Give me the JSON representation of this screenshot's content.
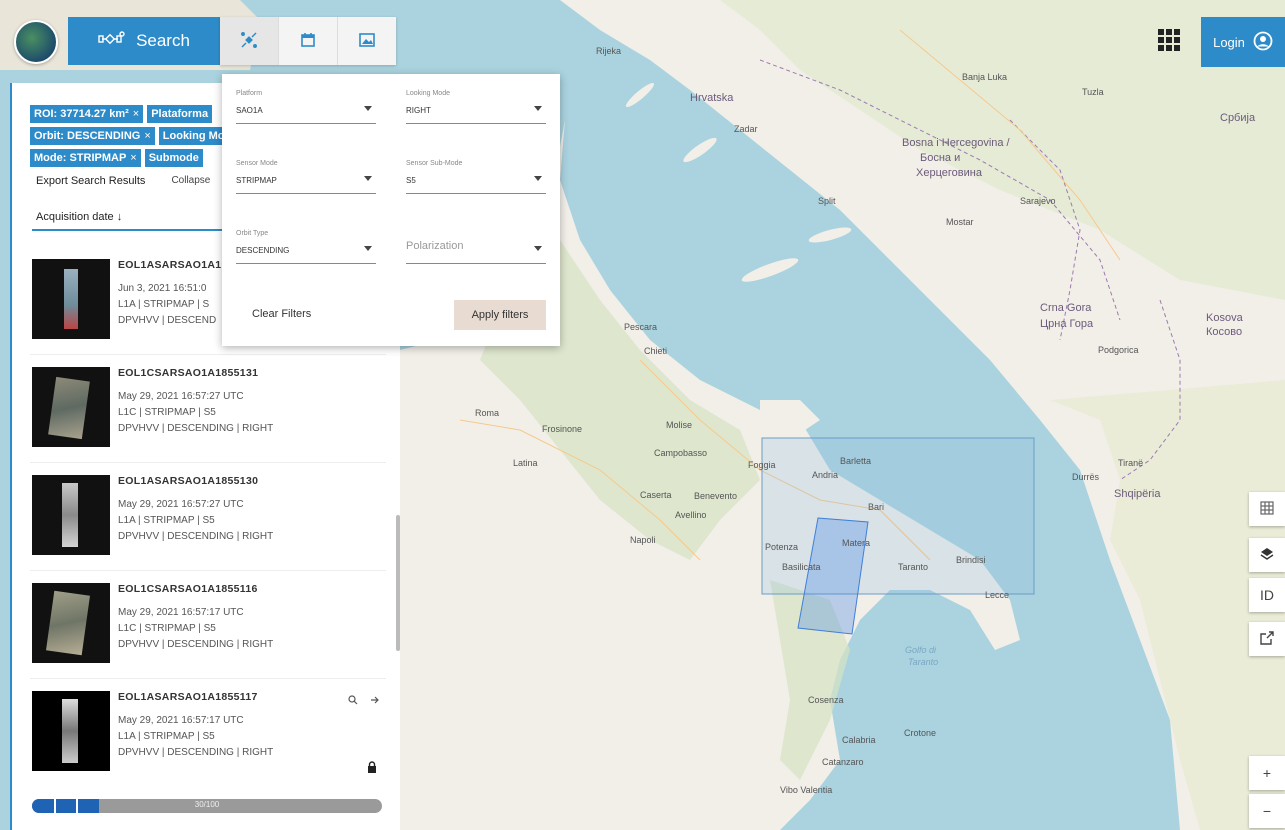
{
  "header": {
    "search_label": "Search",
    "login_label": "Login",
    "tool_tabs": [
      {
        "icon": "satellite-icon"
      },
      {
        "icon": "calendar-icon"
      },
      {
        "icon": "image-icon"
      }
    ]
  },
  "filters_chips": [
    {
      "label": "ROI: 37714.27 km²",
      "close": "×"
    },
    {
      "label": "Plataforma",
      "close": "×"
    },
    {
      "label": "Orbit: DESCENDING",
      "close": "×"
    },
    {
      "label": "Looking Mode",
      "close": "×"
    },
    {
      "label": "Mode: STRIPMAP",
      "close": "×"
    },
    {
      "label": "Submode",
      "close": "×"
    }
  ],
  "panel": {
    "export_label": "Export Search Results",
    "collapse_label": "Collapse",
    "sort_label": "Acquisition date ↓"
  },
  "filter_popup": {
    "platform": {
      "label": "Platform",
      "value": "SAO1A"
    },
    "looking_mode": {
      "label": "Looking Mode",
      "value": "RIGHT"
    },
    "sensor_mode": {
      "label": "Sensor Mode",
      "value": "STRIPMAP"
    },
    "sensor_submode": {
      "label": "Sensor Sub-Mode",
      "value": "S5"
    },
    "orbit_type": {
      "label": "Orbit Type",
      "value": "DESCENDING"
    },
    "polarization": {
      "placeholder": "Polarization"
    },
    "clear_label": "Clear Filters",
    "apply_label": "Apply filters"
  },
  "results": [
    {
      "id": "EOL1ASARSAO1A1",
      "date": "Jun 3, 2021 16:51:0",
      "level": "L1A | STRIPMAP | S",
      "pol": "DPVHVV | DESCEND"
    },
    {
      "id": "EOL1CSARSAO1A1855131",
      "date": "May 29, 2021 16:57:27 UTC",
      "level": "L1C | STRIPMAP | S5",
      "pol": "DPVHVV | DESCENDING | RIGHT"
    },
    {
      "id": "EOL1ASARSAO1A1855130",
      "date": "May 29, 2021 16:57:27 UTC",
      "level": "L1A | STRIPMAP | S5",
      "pol": "DPVHVV | DESCENDING | RIGHT"
    },
    {
      "id": "EOL1CSARSAO1A1855116",
      "date": "May 29, 2021 16:57:17 UTC",
      "level": "L1C | STRIPMAP | S5",
      "pol": "DPVHVV | DESCENDING | RIGHT"
    },
    {
      "id": "EOL1ASARSAO1A1855117",
      "date": "May 29, 2021 16:57:17 UTC",
      "level": "L1A | STRIPMAP | S5",
      "pol": "DPVHVV | DESCENDING | RIGHT"
    }
  ],
  "progress": {
    "fraction": 0.19,
    "label": "30/100"
  },
  "map_controls": [
    {
      "icon": "grid-icon"
    },
    {
      "icon": "layers-icon"
    },
    {
      "label": "ID"
    },
    {
      "icon": "export-icon"
    },
    {
      "label": "+"
    },
    {
      "label": "−"
    }
  ],
  "map_labels": {
    "hrvatska": "Hrvatska",
    "bosna": "Bosna i Hercegovina /",
    "bosna2": "Босна и",
    "bosna3": "Херцеговина",
    "crna_gora": "Crna Gora",
    "crna_gora2": "Црна Гора",
    "shqiperia": "Shqipëria",
    "kosovo": "Kosova",
    "kosovo2": "Косово",
    "srbija": "Србија",
    "roma": "Roma",
    "napoli": "Napoli",
    "bari": "Bari",
    "foggia": "Foggia",
    "split": "Split",
    "zadar": "Zadar",
    "pescara": "Pescara",
    "chieti": "Chieti",
    "latina": "Latina",
    "caserta": "Caserta",
    "avellino": "Avellino",
    "potenza": "Potenza",
    "matera": "Matera",
    "taranto": "Taranto",
    "brindisi": "Brindisi",
    "lecce": "Lecce",
    "cosenza": "Cosenza",
    "catanzaro": "Catanzaro",
    "crotone": "Crotone",
    "vibo": "Vibo Valentia",
    "tirane": "Tiranë",
    "durres": "Durrës",
    "podgorica": "Podgorica",
    "mostar": "Mostar",
    "sarajevo": "Sarajevo",
    "rijeka": "Rijeka",
    "banja_luka": "Banja Luka",
    "tuzla": "Tuzla",
    "andria": "Andria",
    "barletta": "Barletta",
    "benevento": "Benevento",
    "campobasso": "Campobasso",
    "frosinone": "Frosinone",
    "basilicata": "Basilicata",
    "molise": "Molise",
    "calabria": "Calabria",
    "golfo": "Golfo di",
    "golfo2": "Taranto"
  },
  "colors": {
    "accent": "#2e8bc9",
    "sea": "#aad3df",
    "land": "#f2efe9",
    "selection": "#2f6fd6"
  }
}
